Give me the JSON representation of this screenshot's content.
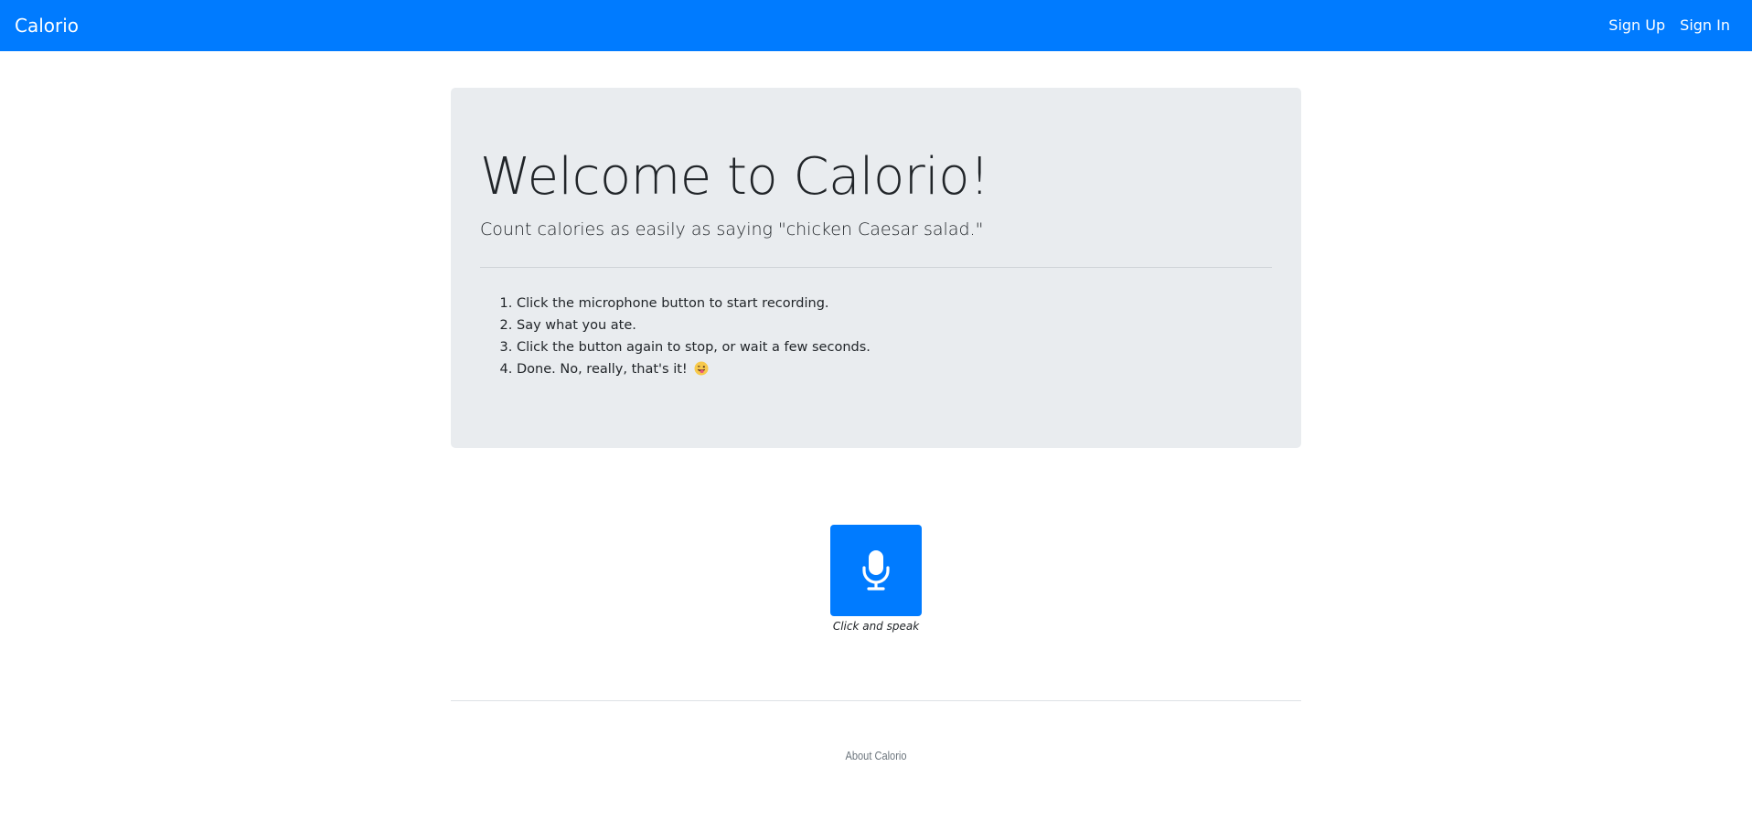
{
  "nav": {
    "brand": "Calorio",
    "links": [
      "Sign Up",
      "Sign In"
    ],
    "color": "#007bff"
  },
  "hero": {
    "title": "Welcome to Calorio!",
    "subtitle": "Count calories as easily as saying \"chicken Caesar salad.\"",
    "steps": [
      "Click the microphone button to start recording.",
      "Say what you ate.",
      "Click the button again to stop, or wait a few seconds.",
      "Done. No, really, that's it!"
    ],
    "emoji": "tongue-out-wink-emoji"
  },
  "mic": {
    "icon": "microphone-icon",
    "caption": "Click and speak"
  },
  "footer": {
    "link": "About Calorio"
  }
}
